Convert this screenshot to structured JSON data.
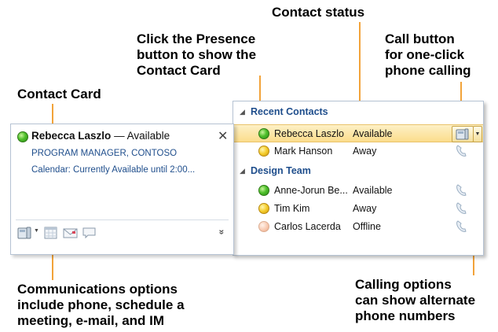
{
  "callouts": {
    "contact_status": "Contact status",
    "presence_line1": "Click the Presence",
    "presence_line2": "button to show the",
    "presence_line3": "Contact Card",
    "call_line1": "Call button",
    "call_line2": "for one-click",
    "call_line3": "phone calling",
    "contact_card": "Contact Card",
    "comm_line1": "Communications options",
    "comm_line2": "include phone, schedule a",
    "comm_line3": "meeting, e-mail, and IM",
    "calling_line1": "Calling options",
    "calling_line2": "can show alternate",
    "calling_line3": "phone numbers"
  },
  "contact_list": {
    "groups": [
      {
        "name": "Recent Contacts",
        "contacts": [
          {
            "name": "Rebecca Laszlo",
            "status": "Available",
            "presence": "green",
            "selected": true
          },
          {
            "name": "Mark Hanson",
            "status": "Away",
            "presence": "yellow"
          }
        ]
      },
      {
        "name": "Design Team",
        "contacts": [
          {
            "name": "Anne-Jorun Be...",
            "status": "Available",
            "presence": "green"
          },
          {
            "name": "Tim Kim",
            "status": "Away",
            "presence": "yellow"
          },
          {
            "name": "Carlos Lacerda",
            "status": "Offline",
            "presence": "peach"
          }
        ]
      }
    ]
  },
  "card": {
    "name": "Rebecca Laszlo",
    "availability": "— Available",
    "title": "PROGRAM MANAGER, CONTOSO",
    "calendar": "Calendar: Currently Available until 2:00...",
    "close_glyph": "✕",
    "expand_glyph": "»",
    "toolbar_icons": [
      "phone-icon",
      "calendar-icon",
      "email-icon",
      "im-icon"
    ]
  },
  "colors": {
    "accent_line": "#f2a33a",
    "link_blue": "#1f4e8c",
    "selection": "#fbdd8c"
  }
}
